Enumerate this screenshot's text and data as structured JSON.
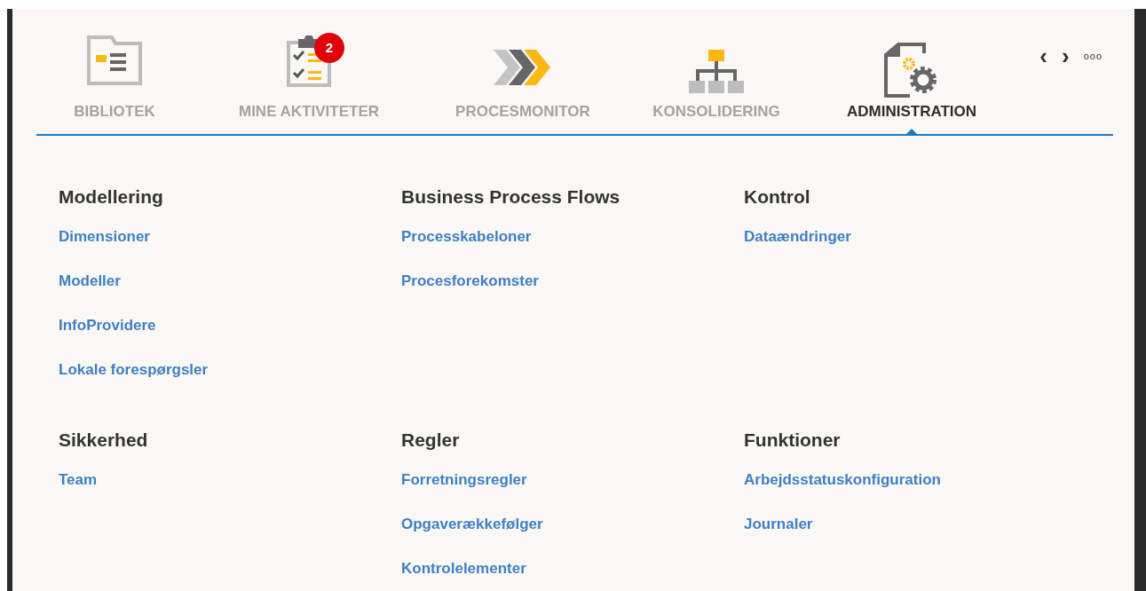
{
  "tabs": [
    {
      "label": "BIBLIOTEK",
      "kind": "folder",
      "selected": false
    },
    {
      "label": "MINE AKTIVITETER",
      "kind": "checklist",
      "selected": false,
      "badge": "2"
    },
    {
      "label": "PROCESMONITOR",
      "kind": "chevrons",
      "selected": false
    },
    {
      "label": "KONSOLIDERING",
      "kind": "hierarchy",
      "selected": false
    },
    {
      "label": "ADMINISTRATION",
      "kind": "gears",
      "selected": true
    }
  ],
  "nav": {
    "prev": "‹",
    "next": "›",
    "more": "ooo"
  },
  "sections": [
    {
      "title": "Modellering",
      "links": [
        "Dimensioner",
        "Modeller",
        "InfoProvidere",
        "Lokale forespørgsler"
      ]
    },
    {
      "title": "Business Process Flows",
      "links": [
        "Processkabeloner",
        "Procesforekomster"
      ]
    },
    {
      "title": "Kontrol",
      "links": [
        "Dataændringer"
      ]
    },
    {
      "title": "Sikkerhed",
      "links": [
        "Team"
      ]
    },
    {
      "title": "Regler",
      "links": [
        "Forretningsregler",
        "Opgaverækkefølger",
        "Kontrolelementer"
      ]
    },
    {
      "title": "Funktioner",
      "links": [
        "Arbejdsstatuskonfiguration",
        "Journaler"
      ]
    }
  ]
}
